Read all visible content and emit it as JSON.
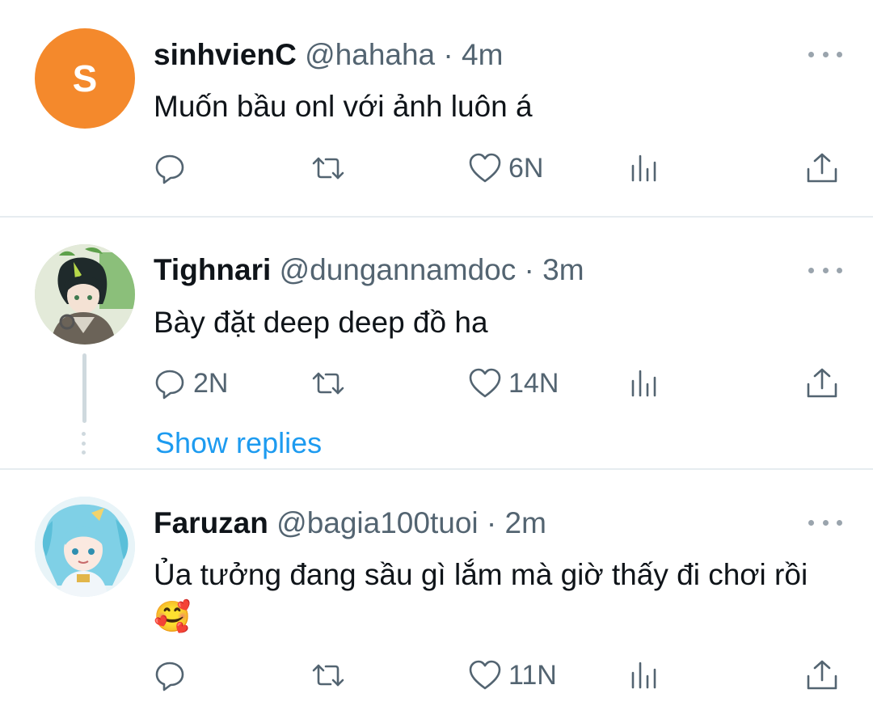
{
  "tweets": [
    {
      "display_name": "sinhvienC",
      "handle": "@hahaha",
      "separator": " · ",
      "time": "4m",
      "avatar_letter": "S",
      "text": "Muốn bầu onl với ảnh luôn á",
      "replies": "",
      "retweets": "",
      "likes": "6N"
    },
    {
      "display_name": "Tighnari",
      "handle": "@dungannamdoc",
      "separator": " · ",
      "time": "3m",
      "text": "Bày đặt deep deep đồ ha",
      "replies": "2N",
      "retweets": "",
      "likes": "14N",
      "show_replies": "Show replies"
    },
    {
      "display_name": "Faruzan",
      "handle": "@bagia100tuoi",
      "separator": " · ",
      "time": "2m",
      "text": "Ủa tưởng đang sầu gì lắm mà giờ thấy đi chơi rồi",
      "emoji": "🥰",
      "replies": "",
      "retweets": "",
      "likes": "11N"
    }
  ],
  "colors": {
    "accent": "#1d9bf0",
    "text": "#0f1419",
    "secondary": "#536471",
    "divider": "#e6ecf0",
    "avatar_s": "#f4892c"
  },
  "icons": [
    "reply-icon",
    "retweet-icon",
    "like-icon",
    "views-icon",
    "share-icon",
    "more-icon"
  ]
}
